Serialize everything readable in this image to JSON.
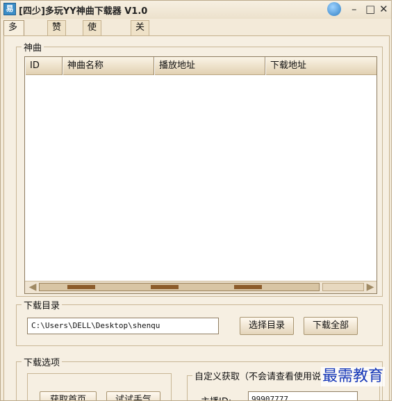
{
  "window": {
    "icon_glyph": "易",
    "title": "[四少]多玩YY神曲下载器 V1.0",
    "controls": {
      "minimize": "–",
      "maximize": "□",
      "close": "✕"
    }
  },
  "tabs": [
    {
      "label": "多玩YY",
      "active": true
    },
    {
      "label": "赞助",
      "active": false
    },
    {
      "label": "使用说明",
      "active": false
    },
    {
      "label": "关于",
      "active": false
    }
  ],
  "songs_group": {
    "legend": "神曲",
    "columns": [
      "ID",
      "神曲名称",
      "播放地址",
      "下载地址"
    ],
    "rows": []
  },
  "download_dir_group": {
    "legend": "下载目录",
    "path": "C:\\Users\\DELL\\Desktop\\shenqu",
    "choose_dir_label": "选择目录",
    "download_all_label": "下载全部"
  },
  "options_group": {
    "legend": "下载选项",
    "fetch_home_label": "获取首页",
    "try_luck_label": "试试手气",
    "custom_legend": "自定义获取（不会请查看使用说",
    "anchor_id_label": "主播ID:",
    "anchor_id_value": "99907777"
  },
  "watermark": "最需教育"
}
